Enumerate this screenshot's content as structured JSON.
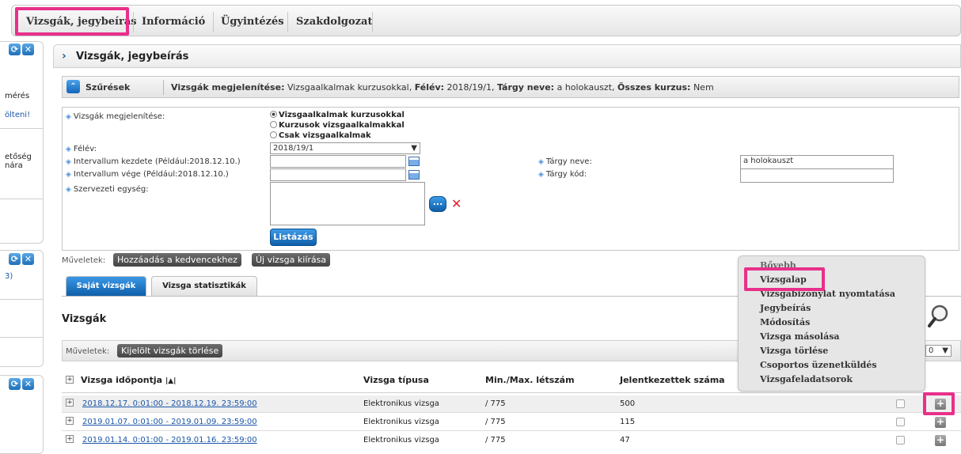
{
  "top_menu": {
    "items": [
      "Vizsgák, jegybeírás",
      "Információ",
      "Ügyintézés",
      "Szakdolgozat"
    ]
  },
  "left_panel": {
    "texts": [
      "mérés",
      "ölteni!",
      "etőség",
      "nára",
      "3)"
    ]
  },
  "page": {
    "title": "Vizsgák, jegybeírás"
  },
  "filter_bar": {
    "label": "Szűrések",
    "summary_label_1": "Vizsgák megjelenítése:",
    "summary_value_1": " Vizsgaalkalmak kurzusokkal, ",
    "summary_label_2": "Félév:",
    "summary_value_2": " 2018/19/1, ",
    "summary_label_3": "Tárgy neve:",
    "summary_value_3": " a holokauszt, ",
    "summary_label_4": "Összes kurzus:",
    "summary_value_4": " Nem"
  },
  "filters": {
    "display_label": "Vizsgák megjelenítése:",
    "radio_options": [
      "Vizsgaalkalmak kurzusokkal",
      "Kurzusok vizsgaalkalmakkal",
      "Csak vizsgaalkalmak"
    ],
    "semester_label": "Félév:",
    "semester_value": "2018/19/1",
    "interval_start_label": "Intervallum kezdete (Például:2018.12.10.)",
    "interval_end_label": "Intervallum vége (Például:2018.12.10.)",
    "org_unit_label": "Szervezeti egység:",
    "subject_name_label": "Tárgy neve:",
    "subject_name_value": "a holokauszt",
    "subject_code_label": "Tárgy kód:",
    "list_button": "Listázás",
    "browse_button": "..."
  },
  "operations": {
    "label": "Műveletek:",
    "add_favorite": "Hozzáadás a kedvencekhez",
    "new_exam": "Új vizsga kiírása"
  },
  "tabs": [
    "Saját vizsgák",
    "Vizsga statisztikák"
  ],
  "exams": {
    "title": "Vizsgák",
    "ops_label": "Műveletek:",
    "delete_selected": "Kijelölt vizsgák törlése",
    "page_size_fragment": "0",
    "columns": [
      "Vizsga időpontja",
      "Vizsga típusa",
      "Min./Max. létszám",
      "Jelentkezettek száma"
    ],
    "rows": [
      {
        "date": "2018.12.17. 0:01:00 - 2018.12.19. 23:59:00",
        "type": "Elektronikus vizsga",
        "limit": "/ 775",
        "registered": "500"
      },
      {
        "date": "2019.01.07. 0:01:00 - 2019.01.09. 23:59:00",
        "type": "Elektronikus vizsga",
        "limit": "/ 775",
        "registered": "115"
      },
      {
        "date": "2019.01.14. 0:01:00 - 2019.01.16. 23:59:00",
        "type": "Elektronikus vizsga",
        "limit": "/ 775",
        "registered": "47"
      }
    ]
  },
  "context_menu": {
    "items": [
      "Bővebb",
      "Vizsgalap",
      "Vizsgabizonylat nyomtatása",
      "Jegybeírás",
      "Módosítás",
      "Vizsga másolása",
      "Vizsga törlése",
      "Csoportos üzenetküldés",
      "Vizsgafeladatsorok"
    ]
  },
  "colors": {
    "highlight": "#e8308a",
    "accent_blue": "#1466b8",
    "link": "#1a56a8"
  }
}
